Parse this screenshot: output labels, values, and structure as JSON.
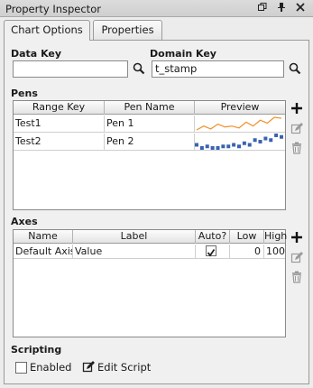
{
  "window": {
    "title": "Property Inspector"
  },
  "tabs": [
    {
      "label": "Chart Options"
    },
    {
      "label": "Properties"
    }
  ],
  "keys": {
    "data_key_label": "Data Key",
    "data_key_value": "",
    "domain_key_label": "Domain Key",
    "domain_key_value": "t_stamp"
  },
  "pens": {
    "section_label": "Pens",
    "columns": [
      "Range Key",
      "Pen Name",
      "Preview"
    ],
    "rows": [
      {
        "range_key": "Test1",
        "pen_name": "Pen 1",
        "preview_style": "line",
        "color": "#f0902a",
        "values": [
          2,
          6,
          3,
          8,
          5,
          6,
          4,
          10,
          6,
          12,
          9,
          15,
          14
        ]
      },
      {
        "range_key": "Test2",
        "pen_name": "Pen 2",
        "preview_style": "bars",
        "color": "#3a62b0",
        "values": [
          3,
          1,
          2,
          1,
          1,
          2,
          2,
          3,
          2,
          4,
          3,
          6,
          5,
          7,
          6,
          9,
          8
        ]
      }
    ]
  },
  "axes": {
    "section_label": "Axes",
    "columns": [
      "Name",
      "Label",
      "Auto?",
      "Low",
      "High"
    ],
    "rows": [
      {
        "name": "Default Axis",
        "label": "Value",
        "auto": true,
        "low": "0",
        "high": "100"
      }
    ]
  },
  "scripting": {
    "section_label": "Scripting",
    "enabled_label": "Enabled",
    "enabled": false,
    "edit_script_label": "Edit Script"
  },
  "colors": {
    "add": "#111111",
    "edit": "#9a9a9a",
    "delete": "#9a9a9a",
    "checkmark": "#222222"
  }
}
